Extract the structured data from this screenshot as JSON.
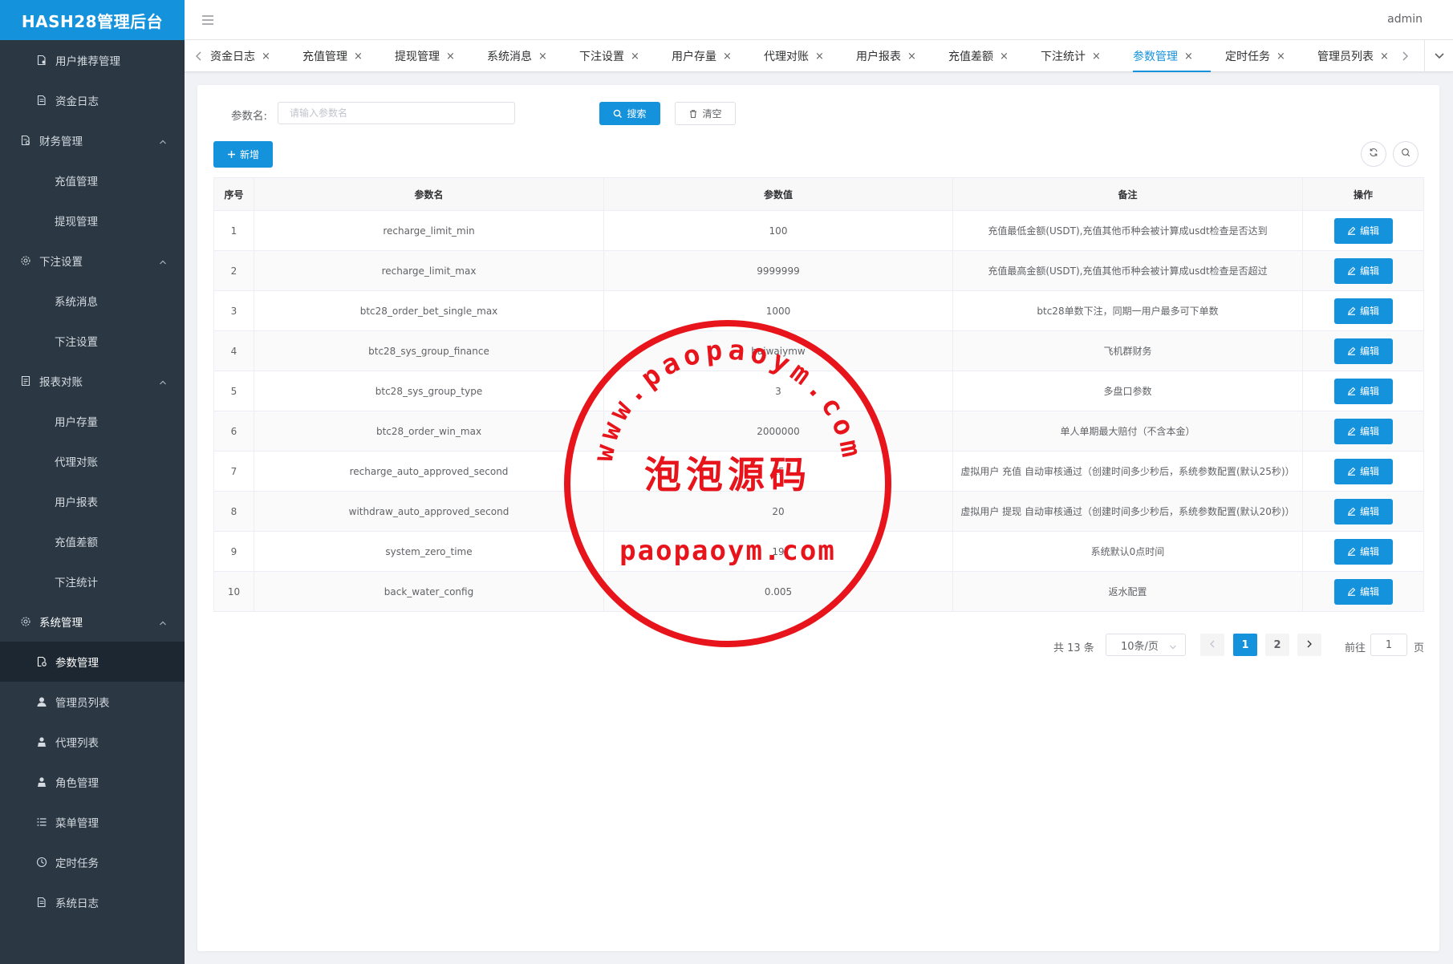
{
  "app": {
    "title": "HASH28管理后台",
    "user": "admin"
  },
  "sidebar": {
    "items": [
      {
        "label": "用户推荐管理",
        "icon": "document-user-icon",
        "level": 2,
        "withIcon": true
      },
      {
        "label": "资金日志",
        "icon": "document-icon",
        "level": 2,
        "withIcon": true
      },
      {
        "label": "财务管理",
        "icon": "finance-document-icon",
        "level": 1,
        "expanded": true
      },
      {
        "label": "充值管理",
        "level": 2
      },
      {
        "label": "提现管理",
        "level": 2
      },
      {
        "label": "下注设置",
        "icon": "gear-icon",
        "level": 1,
        "expanded": true
      },
      {
        "label": "系统消息",
        "level": 2
      },
      {
        "label": "下注设置",
        "level": 2
      },
      {
        "label": "报表对账",
        "icon": "report-icon",
        "level": 1,
        "expanded": true
      },
      {
        "label": "用户存量",
        "level": 2
      },
      {
        "label": "代理对账",
        "level": 2
      },
      {
        "label": "用户报表",
        "level": 2
      },
      {
        "label": "充值差额",
        "level": 2
      },
      {
        "label": "下注统计",
        "level": 2
      },
      {
        "label": "系统管理",
        "icon": "gear-icon",
        "level": 1,
        "expanded": true,
        "bold": true
      },
      {
        "label": "参数管理",
        "icon": "document-gear-icon",
        "level": 2,
        "withIcon": true,
        "active": true
      },
      {
        "label": "管理员列表",
        "icon": "user-icon",
        "level": 2,
        "withIcon": true
      },
      {
        "label": "代理列表",
        "icon": "agent-icon",
        "level": 2,
        "withIcon": true
      },
      {
        "label": "角色管理",
        "icon": "agent-icon",
        "level": 2,
        "withIcon": true
      },
      {
        "label": "菜单管理",
        "icon": "list-icon",
        "level": 2,
        "withIcon": true
      },
      {
        "label": "定时任务",
        "icon": "clock-icon",
        "level": 2,
        "withIcon": true
      },
      {
        "label": "系统日志",
        "icon": "document-icon",
        "level": 2,
        "withIcon": true
      }
    ]
  },
  "tabs": [
    {
      "label": "资金日志"
    },
    {
      "label": "充值管理"
    },
    {
      "label": "提现管理"
    },
    {
      "label": "系统消息"
    },
    {
      "label": "下注设置"
    },
    {
      "label": "用户存量"
    },
    {
      "label": "代理对账"
    },
    {
      "label": "用户报表"
    },
    {
      "label": "充值差额"
    },
    {
      "label": "下注统计"
    },
    {
      "label": "参数管理",
      "active": true
    },
    {
      "label": "定时任务"
    },
    {
      "label": "管理员列表"
    }
  ],
  "search": {
    "label": "参数名:",
    "placeholder": "请输入参数名",
    "value": "",
    "search_label": "搜索",
    "clear_label": "清空"
  },
  "toolbar": {
    "add_label": "新增"
  },
  "table": {
    "headers": [
      "序号",
      "参数名",
      "参数值",
      "备注",
      "操作"
    ],
    "edit_label": "编辑",
    "rows": [
      {
        "index": "1",
        "name": "recharge_limit_min",
        "value": "100",
        "remark": "充值最低金额(USDT),充值其他币种会被计算成usdt检查是否达到"
      },
      {
        "index": "2",
        "name": "recharge_limit_max",
        "value": "9999999",
        "remark": "充值最高金额(USDT),充值其他币种会被计算成usdt检查是否超过"
      },
      {
        "index": "3",
        "name": "btc28_order_bet_single_max",
        "value": "1000",
        "remark": "btc28单数下注，同期一用户最多可下单数"
      },
      {
        "index": "4",
        "name": "btc28_sys_group_finance",
        "value": "haiwaiymw",
        "remark": "飞机群财务"
      },
      {
        "index": "5",
        "name": "btc28_sys_group_type",
        "value": "3",
        "remark": "多盘口参数"
      },
      {
        "index": "6",
        "name": "btc28_order_win_max",
        "value": "2000000",
        "remark": "单人单期最大赔付（不含本金）"
      },
      {
        "index": "7",
        "name": "recharge_auto_approved_second",
        "value": "25",
        "remark": "虚拟用户 充值 自动审核通过（创建时间多少秒后，系统参数配置(默认25秒)）"
      },
      {
        "index": "8",
        "name": "withdraw_auto_approved_second",
        "value": "20",
        "remark": "虚拟用户 提现 自动审核通过（创建时间多少秒后，系统参数配置(默认20秒)）"
      },
      {
        "index": "9",
        "name": "system_zero_time",
        "value": "19",
        "remark": "系统默认0点时间"
      },
      {
        "index": "10",
        "name": "back_water_config",
        "value": "0.005",
        "remark": "返水配置"
      }
    ]
  },
  "pagination": {
    "total_text": "共 13 条",
    "page_size": "10条/页",
    "pages": [
      "1",
      "2"
    ],
    "current": "1",
    "goto_label": "前往",
    "goto_value": "1",
    "goto_suffix": "页"
  },
  "watermark": {
    "top_arc": "www.paopaoym.com",
    "middle": "泡泡源码",
    "bottom": "paopaoym.com",
    "color": "#e8141b"
  },
  "colors": {
    "primary": "#1592dc",
    "sidebar_bg": "#2b3844",
    "sidebar_active": "#1d2731"
  }
}
